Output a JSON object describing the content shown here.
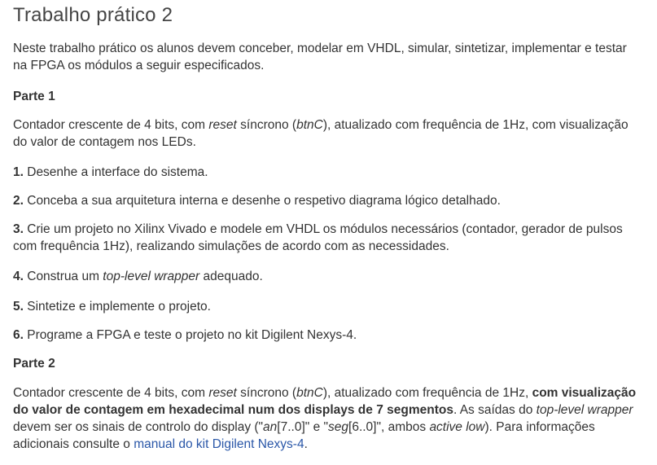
{
  "title": "Trabalho prático 2",
  "intro": "Neste trabalho prático os alunos devem conceber, modelar em VHDL, simular, sintetizar, implementar e testar na FPGA os módulos a seguir especificados.",
  "part1": {
    "heading": "Parte 1",
    "desc": {
      "a": "Contador crescente de 4 bits, com ",
      "reset": "reset",
      "b": " síncrono (",
      "btn": "btnC",
      "c": "), atualizado com frequência de 1Hz, com visualização do valor de contagem nos LEDs."
    },
    "steps": [
      {
        "n": "1.",
        "text": " Desenhe a interface do sistema."
      },
      {
        "n": "2.",
        "text": " Conceba a sua arquitetura interna e desenhe o respetivo diagrama lógico detalhado."
      },
      {
        "n": "3.",
        "text": " Crie um projeto no Xilinx Vivado e modele em VHDL os módulos necessários (contador, gerador de pulsos com frequência 1Hz), realizando simulações de acordo com as necessidades."
      },
      {
        "n": "4.",
        "pre": " Construa um ",
        "em": "top-level wrapper",
        "post": " adequado."
      },
      {
        "n": "5.",
        "text": " Sintetize e implemente o projeto."
      },
      {
        "n": "6.",
        "text": " Programe a FPGA e teste o projeto no kit Digilent Nexys-4."
      }
    ]
  },
  "part2": {
    "heading": "Parte 2",
    "a": "Contador crescente de 4 bits, com ",
    "reset": "reset",
    "b": " síncrono (",
    "btn": "btnC",
    "c": "), atualizado com frequência de 1Hz, ",
    "bold": "com visualização do valor de contagem em hexadecimal num dos displays de 7 segmentos",
    "d": ". As saídas do ",
    "tlw": "top-level wrapper",
    "e": " devem ser os sinais de controlo do display (\"",
    "an": "an",
    "f": "[7..0]\" e \"",
    "seg": "seg",
    "g": "[6..0]\", ambos ",
    "al": "active low",
    "h": "). Para informações adicionais consulte o ",
    "link": "manual do kit Digilent Nexys-4",
    "i": "."
  }
}
